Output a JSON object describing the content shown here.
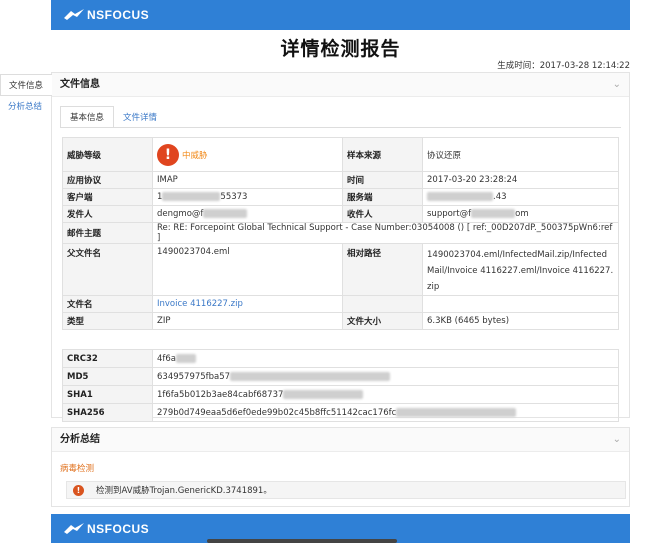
{
  "header": {
    "brand": "NSFOCUS"
  },
  "report": {
    "title": "详情检测报告",
    "generated_label": "生成时间：",
    "generated_time": "2017-03-28 12:14:22"
  },
  "leftnav": {
    "items": [
      {
        "label": "文件信息"
      },
      {
        "label": "分析总结"
      }
    ]
  },
  "file_info": {
    "section_title": "文件信息",
    "tabs": [
      {
        "label": "基本信息"
      },
      {
        "label": "文件详情"
      }
    ],
    "threat_level_label": "威胁等级",
    "threat_level_value": "中威胁",
    "sample_source_label": "样本来源",
    "sample_source_value": "协议还原",
    "protocol_label": "应用协议",
    "protocol_value": "IMAP",
    "time_label": "时间",
    "time_value": "2017-03-20 23:28:24",
    "client_label": "客户端",
    "client_value_prefix": "1",
    "client_value_suffix": "55373",
    "server_label": "服务端",
    "server_value_suffix": ".43",
    "sender_label": "发件人",
    "sender_value": "dengmo@f",
    "recipient_label": "收件人",
    "recipient_value_prefix": "support@f",
    "recipient_value_suffix": "om",
    "subject_label": "邮件主题",
    "subject_value": "Re: RE: Forcepoint Global Technical Support - Case Number:03054008 () [ ref:_00D207dP._500375pWn6:ref ]",
    "parent_file_label": "父文件名",
    "parent_file_value": "1490023704.eml",
    "rel_path_label": "相对路径",
    "rel_path_value": "1490023704.eml/InfectedMail.zip/InfectedMail/Invoice 4116227.eml/Invoice 4116227.zip",
    "filename_label": "文件名",
    "filename_value": "Invoice 4116227.zip",
    "type_label": "类型",
    "type_value": "ZIP",
    "size_label": "文件大小",
    "size_value": "6.3KB (6465 bytes)"
  },
  "hashes": [
    {
      "label": "CRC32",
      "value": "4f6a"
    },
    {
      "label": "MD5",
      "value": "634957975fba57"
    },
    {
      "label": "SHA1",
      "value": "1f6fa5b012b3ae84cabf68737"
    },
    {
      "label": "SHA256",
      "value": "279b0d749eaa5d6ef0ede99b02c45b8ffc51142cac176fc"
    }
  ],
  "analysis": {
    "section_title": "分析总结",
    "virus_heading": "病毒检测",
    "alert_icon": "!",
    "alert_text": "检测到AV威胁Trojan.GenericKD.3741891。"
  },
  "footer": {
    "brand": "NSFOCUS"
  },
  "colors": {
    "brand_blue": "#2f80d6",
    "warn_red": "#e0451f",
    "link_blue": "#3a78c7",
    "orange": "#e0721f"
  }
}
